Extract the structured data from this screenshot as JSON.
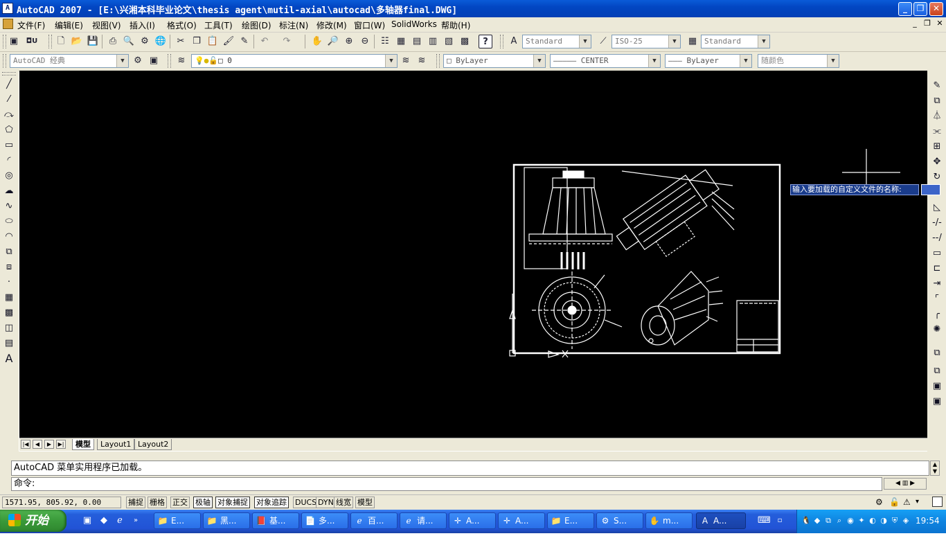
{
  "window": {
    "title": "AutoCAD 2007 - [E:\\兴湘本科毕业论文\\thesis agent\\mutil-axial\\autocad\\多轴器final.DWG]",
    "app_icon": "A",
    "controls": {
      "minimize": "_",
      "restore": "❐",
      "close": "✕"
    }
  },
  "menubar": {
    "items": [
      {
        "label": "文件(F)"
      },
      {
        "label": "编辑(E)"
      },
      {
        "label": "视图(V)"
      },
      {
        "label": "插入(I)"
      },
      {
        "label": "格式(O)"
      },
      {
        "label": "工具(T)"
      },
      {
        "label": "绘图(D)"
      },
      {
        "label": "标注(N)"
      },
      {
        "label": "修改(M)"
      },
      {
        "label": "窗口(W)"
      },
      {
        "label": "SolidWorks"
      },
      {
        "label": "帮助(H)"
      }
    ],
    "doc_controls": {
      "minimize": "_",
      "restore": "❐",
      "close": "✕"
    }
  },
  "toolbar1": {
    "style_text": "Standard",
    "dim_style": "ISO-25",
    "table_style": "Standard"
  },
  "toolbar2": {
    "workspace": "AutoCAD 经典",
    "layer": "0",
    "color": "ByLayer",
    "linetype": "CENTER",
    "lineweight": "ByLayer",
    "plotstyle": "随颜色"
  },
  "prompt": {
    "text": "输入要加载的自定义文件的名称:"
  },
  "layout_tabs": [
    "模型",
    "Layout1",
    "Layout2"
  ],
  "command": {
    "history": "AutoCAD 菜单实用程序已加载。",
    "prompt": "命令:"
  },
  "statusbar": {
    "coords": "1571.95, 805.92, 0.00",
    "toggles": [
      {
        "label": "捕捉",
        "on": false
      },
      {
        "label": "栅格",
        "on": false
      },
      {
        "label": "正交",
        "on": false
      },
      {
        "label": "极轴",
        "on": true
      },
      {
        "label": "对象捕捉",
        "on": true
      },
      {
        "label": "对象追踪",
        "on": true
      },
      {
        "label": "DUCS",
        "on": false
      },
      {
        "label": "DYN",
        "on": false
      },
      {
        "label": "线宽",
        "on": false
      },
      {
        "label": "模型",
        "on": false
      }
    ]
  },
  "taskbar": {
    "start_label": "开始",
    "tasks": [
      {
        "label": "E...",
        "icon": "folder-icon"
      },
      {
        "label": "黑...",
        "icon": "folder-icon"
      },
      {
        "label": "基...",
        "icon": "pdf-icon"
      },
      {
        "label": "多...",
        "icon": "doc-icon"
      },
      {
        "label": "百...",
        "icon": "ie-icon"
      },
      {
        "label": "请...",
        "icon": "ie-icon"
      },
      {
        "label": "A...",
        "icon": "autocad-icon"
      },
      {
        "label": "A...",
        "icon": "autocad-icon"
      },
      {
        "label": "E...",
        "icon": "folder-icon"
      },
      {
        "label": "S...",
        "icon": "solidworks-icon"
      },
      {
        "label": "m...",
        "icon": "app-icon"
      },
      {
        "label": "A...",
        "icon": "autocad-icon",
        "active": true
      }
    ],
    "clock": "19:54"
  },
  "colors": {
    "canvas": "#000000",
    "chrome": "#ece9d8",
    "titlebar": "#0246c2",
    "taskbar": "#245edb",
    "tray": "#0f84e0"
  }
}
